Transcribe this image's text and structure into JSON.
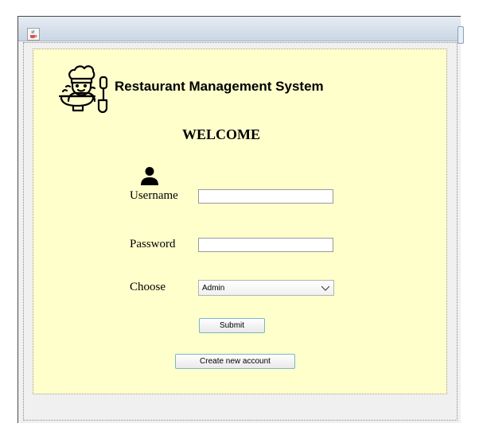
{
  "window": {
    "icons": {
      "app": "java-coffee-icon",
      "logo": "chef-cooking-icon",
      "user": "user-silhouette-icon",
      "chevron": "chevron-down-icon"
    }
  },
  "header": {
    "title": "Restaurant Management System"
  },
  "welcome": "WELCOME",
  "form": {
    "username_label": "Username",
    "username_value": "",
    "password_label": "Password",
    "password_value": "",
    "choose_label": "Choose",
    "choose_selected": "Admin"
  },
  "buttons": {
    "submit": "Submit",
    "create_account": "Create new account"
  },
  "colors": {
    "panel_background": "#ffffcc",
    "button_border": "#7ab6c7"
  }
}
